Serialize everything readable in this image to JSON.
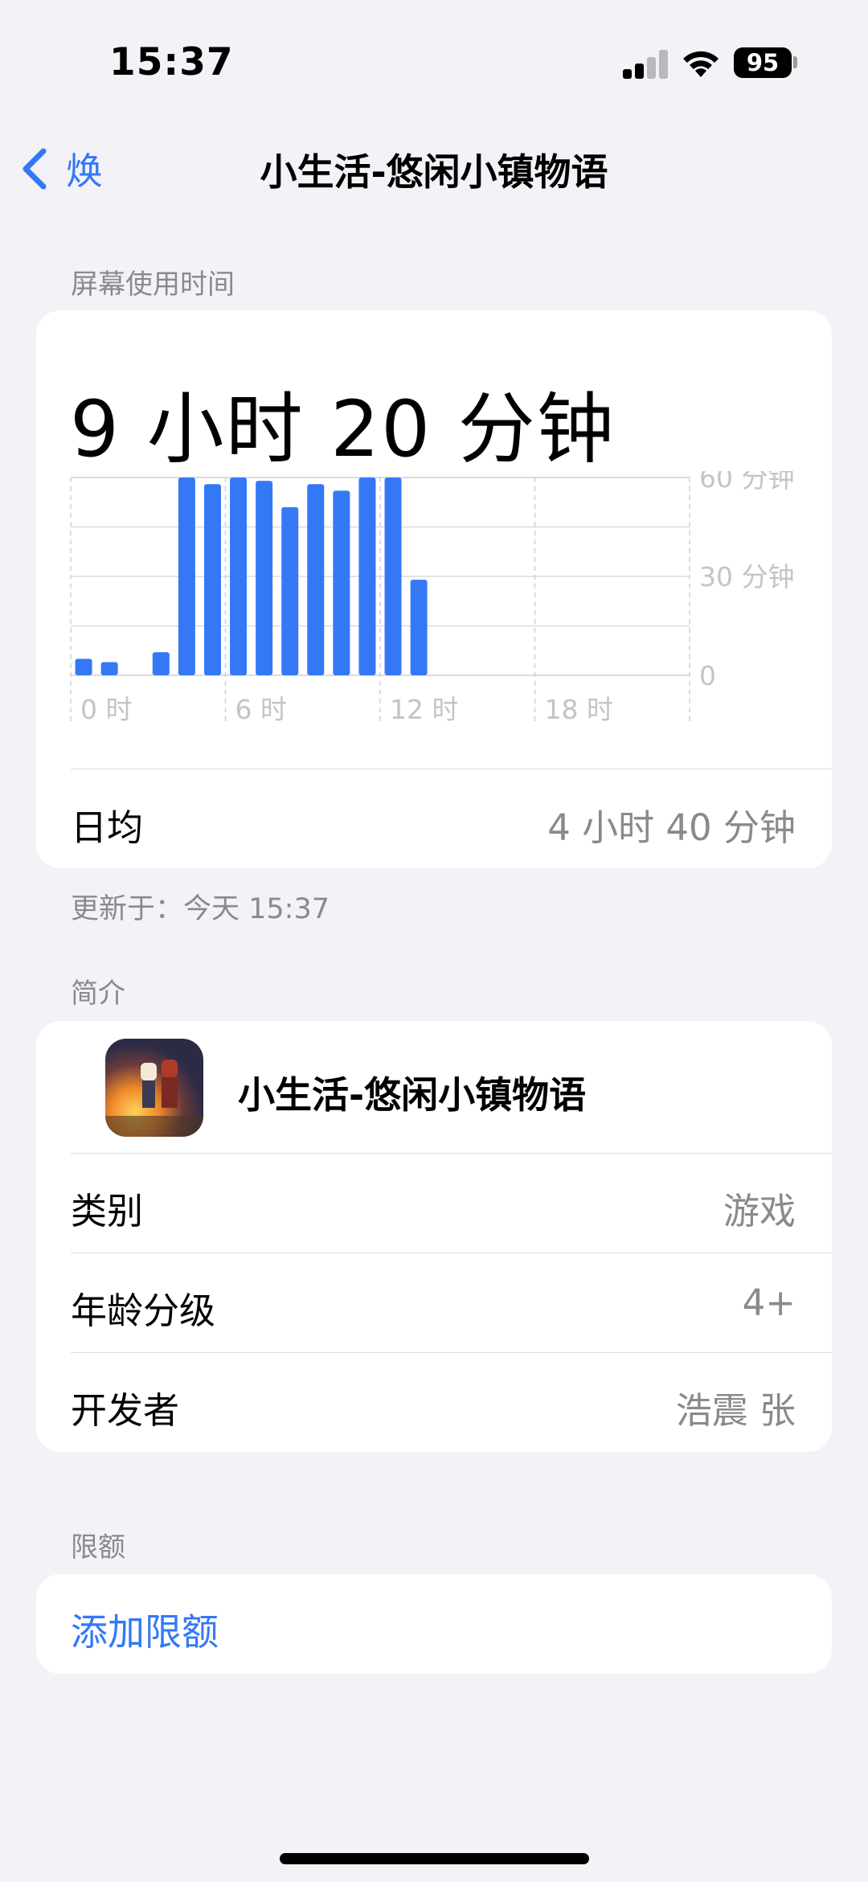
{
  "status_bar": {
    "time": "15:37",
    "battery": "95"
  },
  "nav": {
    "back_label": "焕",
    "title": "小生活-悠闲小镇物语"
  },
  "screen_time": {
    "section_label": "屏幕使用时间",
    "total": "9 小时 20 分钟",
    "daily_avg_label": "日均",
    "daily_avg_value": "4 小时 40 分钟",
    "updated": "更新于：今天 15:37"
  },
  "chart_data": {
    "type": "bar",
    "title": "",
    "xlabel": "",
    "ylabel": "",
    "x_tick_labels": [
      "0 时",
      "6 时",
      "12 时",
      "18 时"
    ],
    "y_tick_labels": [
      "60 分钟",
      "30 分钟",
      "0"
    ],
    "ylim": [
      0,
      60
    ],
    "categories": [
      "0",
      "1",
      "2",
      "3",
      "4",
      "5",
      "6",
      "7",
      "8",
      "9",
      "10",
      "11",
      "12",
      "13",
      "14",
      "15",
      "16",
      "17",
      "18",
      "19",
      "20",
      "21",
      "22",
      "23"
    ],
    "values": [
      5,
      4,
      0,
      7,
      60,
      58,
      60,
      59,
      51,
      58,
      56,
      60,
      60,
      29,
      0,
      0,
      0,
      0,
      0,
      0,
      0,
      0,
      0,
      0
    ],
    "bar_color": "#3478f6",
    "grid": true
  },
  "about": {
    "section_label": "简介",
    "app_name": "小生活-悠闲小镇物语",
    "category_label": "类别",
    "category_value": "游戏",
    "age_label": "年龄分级",
    "age_value": "4+",
    "developer_label": "开发者",
    "developer_value": "浩震 张"
  },
  "limits": {
    "section_label": "限额",
    "add_label": "添加限额"
  },
  "colors": {
    "accent": "#3478f6",
    "background": "#f2f2f7",
    "secondary_text": "#8a8a8e"
  }
}
